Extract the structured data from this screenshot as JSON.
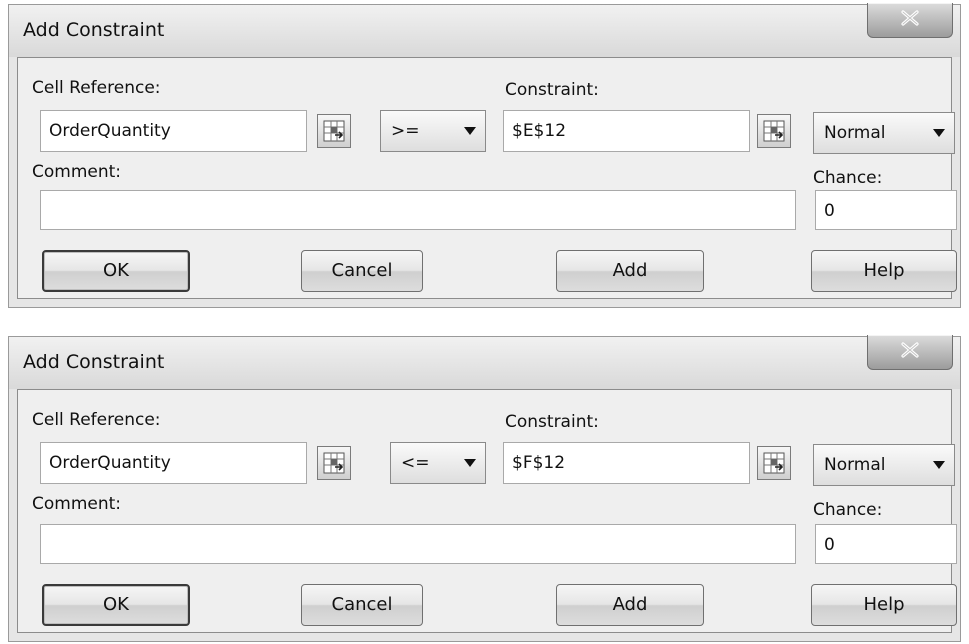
{
  "dialogs": [
    {
      "title": "Add Constraint",
      "cell_reference_label": "Cell Reference:",
      "cell_reference_value": "OrderQuantity",
      "operator": "<span>>=</span>",
      "constraint_label": "Constraint:",
      "constraint_value": "$E$12",
      "distribution": "Normal",
      "comment_label": "Comment:",
      "comment_value": "",
      "chance_label": "Chance:",
      "chance_value": "0",
      "buttons": {
        "ok": "OK",
        "cancel": "Cancel",
        "add": "Add",
        "help": "Help"
      }
    },
    {
      "title": "Add Constraint",
      "cell_reference_label": "Cell Reference:",
      "cell_reference_value": "OrderQuantity",
      "operator": "<=",
      "constraint_label": "Constraint:",
      "constraint_value": "$F$12",
      "distribution": "Normal",
      "comment_label": "Comment:",
      "comment_value": "",
      "chance_label": "Chance:",
      "chance_value": "0",
      "buttons": {
        "ok": "OK",
        "cancel": "Cancel",
        "add": "Add",
        "help": "Help"
      }
    }
  ],
  "icons": {
    "close": "close-icon",
    "cell_picker": "range-select-icon",
    "dropdown": "chevron-down-icon"
  }
}
